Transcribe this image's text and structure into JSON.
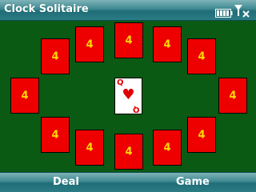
{
  "app": {
    "title": "Clock Solitaire"
  },
  "status": {
    "battery_icon": "battery-icon",
    "signal_icon": "signal-off-icon"
  },
  "board": {
    "card_back_color": "#ee0000",
    "count_color": "#ffd800",
    "felt_color": "#0a5a14",
    "piles": [
      {
        "count": "4"
      },
      {
        "count": "4"
      },
      {
        "count": "4"
      },
      {
        "count": "4"
      },
      {
        "count": "4"
      },
      {
        "count": "4"
      },
      {
        "count": "4"
      },
      {
        "count": "4"
      },
      {
        "count": "4"
      },
      {
        "count": "4"
      },
      {
        "count": "4"
      },
      {
        "count": "4"
      }
    ],
    "center_card": {
      "rank": "Q",
      "suit": "♥",
      "suit_color": "#e00000"
    }
  },
  "softkeys": {
    "left": "Deal",
    "right": "Game"
  }
}
